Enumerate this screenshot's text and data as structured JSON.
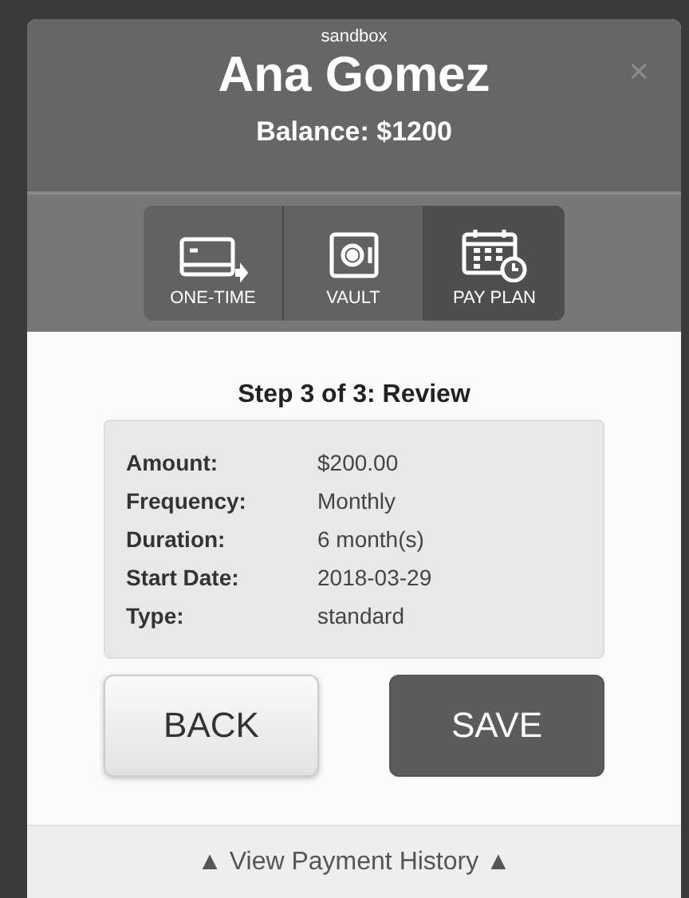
{
  "header": {
    "environment": "sandbox",
    "customer_name": "Ana Gomez",
    "balance": "Balance: $1200",
    "close": "×"
  },
  "tabs": [
    {
      "label": "ONE-TIME",
      "selected": false
    },
    {
      "label": "VAULT",
      "selected": false
    },
    {
      "label": "PAY PLAN",
      "selected": true
    }
  ],
  "step_title": "Step 3 of 3: Review",
  "details": [
    {
      "label": "Amount:",
      "value": "$200.00"
    },
    {
      "label": "Frequency:",
      "value": "Monthly"
    },
    {
      "label": "Duration:",
      "value": "6 month(s)"
    },
    {
      "label": "Start Date:",
      "value": "2018-03-29"
    },
    {
      "label": "Type:",
      "value": "standard"
    }
  ],
  "buttons": {
    "back": "BACK",
    "save": "SAVE"
  },
  "footer_link": "▲ View Payment History ▲"
}
